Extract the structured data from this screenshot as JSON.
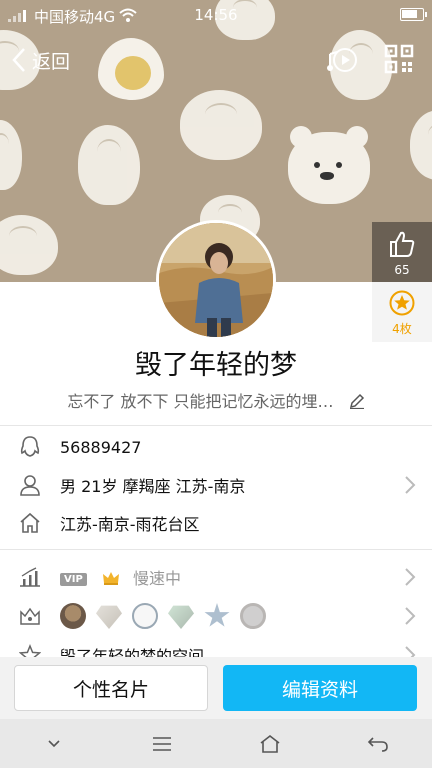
{
  "status_bar": {
    "carrier": "中国移动4G",
    "time": "14:56",
    "battery_level": 0.8
  },
  "nav": {
    "back_label": "返回",
    "icons": [
      "music-play-icon",
      "qr-code-icon"
    ]
  },
  "likes": {
    "count": "65",
    "icon": "thumbs-up-icon"
  },
  "badges": {
    "count": "4枚",
    "icon": "star-badge-icon",
    "color": "#f0a100"
  },
  "profile": {
    "nickname": "毁了年轻的梦",
    "signature": "忘不了 放不下 只能把记忆永远的埋…"
  },
  "info": {
    "qq_number": "56889427",
    "basic": "男  21岁  摩羯座  江苏-南京",
    "hometown": "江苏-南京-雨花台区"
  },
  "level_row": {
    "vip_tag": "VIP",
    "speed_text": "慢速中"
  },
  "medals_row": {
    "icons": [
      "penguin-medal-icon",
      "diamond-medal-icon",
      "cloud-medal-icon",
      "gem-medal-icon",
      "star-medal-icon",
      "bolt-medal-icon"
    ]
  },
  "space_row": {
    "label": "毁了年轻的梦的空间"
  },
  "actions": {
    "card_label": "个性名片",
    "edit_label": "编辑资料",
    "accent": "#12b7f5"
  },
  "system_nav": [
    "collapse-icon",
    "menu-icon",
    "home-icon",
    "back-arrow-icon"
  ]
}
